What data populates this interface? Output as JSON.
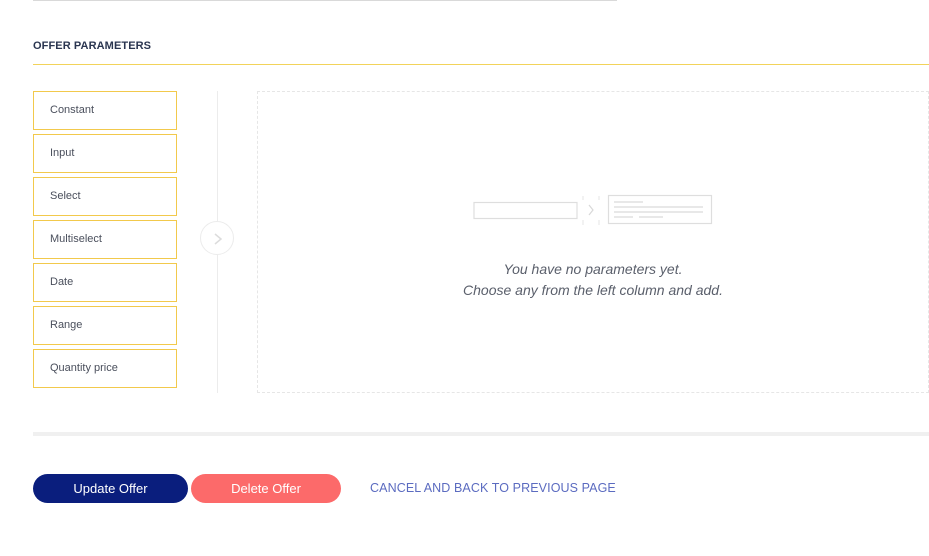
{
  "section": {
    "title": "OFFER PARAMETERS"
  },
  "param_types": [
    {
      "label": "Constant"
    },
    {
      "label": "Input"
    },
    {
      "label": "Select"
    },
    {
      "label": "Multiselect"
    },
    {
      "label": "Date"
    },
    {
      "label": "Range"
    },
    {
      "label": "Quantity price"
    }
  ],
  "empty_state": {
    "line1": "You have no parameters yet.",
    "line2": "Choose any from the left column and add."
  },
  "actions": {
    "update_label": "Update Offer",
    "delete_label": "Delete Offer",
    "cancel_label": "CANCEL AND BACK TO PREVIOUS PAGE"
  },
  "colors": {
    "accent_yellow": "#f2c94c",
    "primary_navy": "#0a1e7d",
    "danger_coral": "#fc6a6a",
    "link_blue": "#5b6bc0"
  },
  "icons": {
    "add_arrow": "chevron-right-icon",
    "empty_state": "empty-params-illustration"
  }
}
